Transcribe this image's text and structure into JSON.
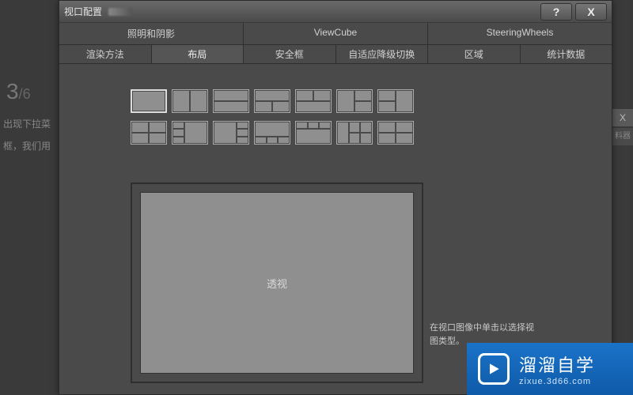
{
  "background": {
    "step_current": "3",
    "step_total": "/6",
    "line1": "出现下拉菜",
    "line2": "框，我们用",
    "right_x": "X",
    "right_strip": "料器"
  },
  "dialog": {
    "title": "视口配置",
    "help_label": "?",
    "close_label": "X"
  },
  "tabs_primary": [
    {
      "label": "照明和阴影",
      "active": false
    },
    {
      "label": "ViewCube",
      "active": false
    },
    {
      "label": "SteeringWheels",
      "active": false
    }
  ],
  "tabs_secondary": [
    {
      "label": "渲染方法",
      "active": false
    },
    {
      "label": "布局",
      "active": true
    },
    {
      "label": "安全框",
      "active": false
    },
    {
      "label": "自适应降级切换",
      "active": false
    },
    {
      "label": "区域",
      "active": false
    },
    {
      "label": "统计数据",
      "active": false
    }
  ],
  "layout_thumbs": [
    "single",
    "2col",
    "2row",
    "1top2bot",
    "2top1bot",
    "1left2right",
    "2left1right",
    "quad",
    "3left1right",
    "1left3right",
    "1top3bot",
    "3top1bot",
    "wide4a",
    "wide4b"
  ],
  "selected_layout": "single",
  "preview": {
    "view_name": "透视"
  },
  "hint": "在视口图像中单击以选择视图类型。",
  "watermark": {
    "brand_big": "溜溜自学",
    "brand_small": "zixue.3d66.com"
  }
}
